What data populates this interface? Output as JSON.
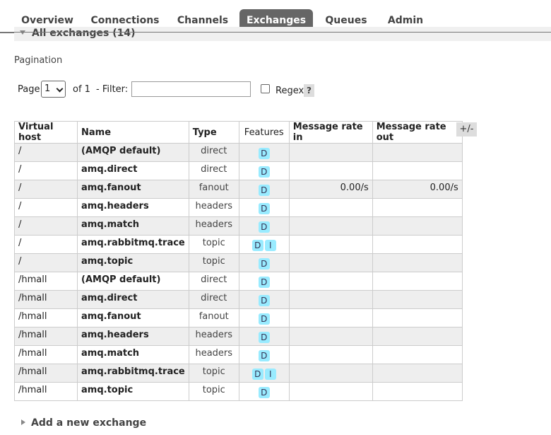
{
  "nav": {
    "tabs": [
      {
        "label": "Overview",
        "active": false
      },
      {
        "label": "Connections",
        "active": false
      },
      {
        "label": "Channels",
        "active": false
      },
      {
        "label": "Exchanges",
        "active": true
      },
      {
        "label": "Queues",
        "active": false
      },
      {
        "label": "Admin",
        "active": false
      }
    ]
  },
  "section": {
    "title": "All exchanges (14)"
  },
  "pagination": {
    "heading": "Pagination",
    "page_label": "Page",
    "page_value": "1",
    "of_label": "of 1",
    "filter_label": "- Filter:",
    "filter_value": "",
    "regex_label": "Regex",
    "regex_checked": false,
    "help": "?"
  },
  "table": {
    "headers": [
      "Virtual host",
      "Name",
      "Type",
      "Features",
      "Message rate in",
      "Message rate out"
    ],
    "toggle": "+/-",
    "rows": [
      {
        "vhost": "/",
        "name": "(AMQP default)",
        "type": "direct",
        "features": [
          "D"
        ],
        "rate_in": "",
        "rate_out": ""
      },
      {
        "vhost": "/",
        "name": "amq.direct",
        "type": "direct",
        "features": [
          "D"
        ],
        "rate_in": "",
        "rate_out": ""
      },
      {
        "vhost": "/",
        "name": "amq.fanout",
        "type": "fanout",
        "features": [
          "D"
        ],
        "rate_in": "0.00/s",
        "rate_out": "0.00/s"
      },
      {
        "vhost": "/",
        "name": "amq.headers",
        "type": "headers",
        "features": [
          "D"
        ],
        "rate_in": "",
        "rate_out": ""
      },
      {
        "vhost": "/",
        "name": "amq.match",
        "type": "headers",
        "features": [
          "D"
        ],
        "rate_in": "",
        "rate_out": ""
      },
      {
        "vhost": "/",
        "name": "amq.rabbitmq.trace",
        "type": "topic",
        "features": [
          "D",
          "I"
        ],
        "rate_in": "",
        "rate_out": ""
      },
      {
        "vhost": "/",
        "name": "amq.topic",
        "type": "topic",
        "features": [
          "D"
        ],
        "rate_in": "",
        "rate_out": ""
      },
      {
        "vhost": "/hmall",
        "name": "(AMQP default)",
        "type": "direct",
        "features": [
          "D"
        ],
        "rate_in": "",
        "rate_out": ""
      },
      {
        "vhost": "/hmall",
        "name": "amq.direct",
        "type": "direct",
        "features": [
          "D"
        ],
        "rate_in": "",
        "rate_out": ""
      },
      {
        "vhost": "/hmall",
        "name": "amq.fanout",
        "type": "fanout",
        "features": [
          "D"
        ],
        "rate_in": "",
        "rate_out": ""
      },
      {
        "vhost": "/hmall",
        "name": "amq.headers",
        "type": "headers",
        "features": [
          "D"
        ],
        "rate_in": "",
        "rate_out": ""
      },
      {
        "vhost": "/hmall",
        "name": "amq.match",
        "type": "headers",
        "features": [
          "D"
        ],
        "rate_in": "",
        "rate_out": ""
      },
      {
        "vhost": "/hmall",
        "name": "amq.rabbitmq.trace",
        "type": "topic",
        "features": [
          "D",
          "I"
        ],
        "rate_in": "",
        "rate_out": ""
      },
      {
        "vhost": "/hmall",
        "name": "amq.topic",
        "type": "topic",
        "features": [
          "D"
        ],
        "rate_in": "",
        "rate_out": ""
      }
    ]
  },
  "add_exchange": {
    "label": "Add a new exchange"
  }
}
